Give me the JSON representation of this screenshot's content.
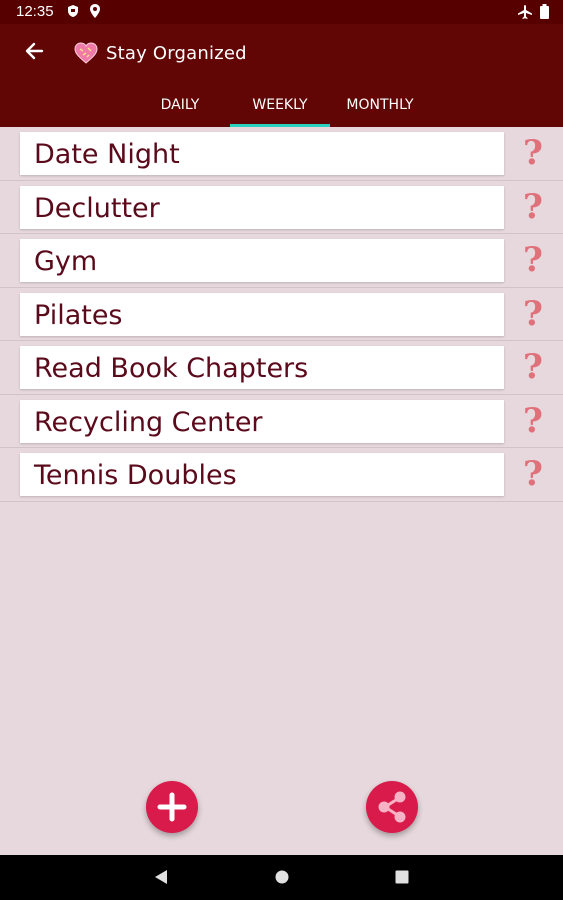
{
  "status_bar": {
    "time": "12:35",
    "icons": [
      "shield-icon",
      "location-pin-icon",
      "airplane-icon",
      "battery-icon"
    ]
  },
  "app_bar": {
    "title": "Stay Organized",
    "back_icon": "back-arrow-icon",
    "logo_icon": "heart-icon",
    "background": "#620505"
  },
  "tabs": [
    {
      "label": "DAILY",
      "active": false
    },
    {
      "label": "WEEKLY",
      "active": true
    },
    {
      "label": "MONTHLY",
      "active": false
    }
  ],
  "tasks": [
    {
      "label": "Date Night",
      "icon": "help-icon"
    },
    {
      "label": "Declutter",
      "icon": "help-icon"
    },
    {
      "label": "Gym",
      "icon": "help-icon"
    },
    {
      "label": "Pilates",
      "icon": "help-icon"
    },
    {
      "label": "Read Book Chapters",
      "icon": "help-icon"
    },
    {
      "label": "Recycling Center",
      "icon": "help-icon"
    },
    {
      "label": "Tennis Doubles",
      "icon": "help-icon"
    }
  ],
  "help_glyph": "?",
  "actions": {
    "add_icon": "plus-icon",
    "share_icon": "share-icon",
    "color": "#d81b4b"
  },
  "nav_bar": [
    "back-triangle-icon",
    "home-circle-icon",
    "recents-square-icon"
  ]
}
